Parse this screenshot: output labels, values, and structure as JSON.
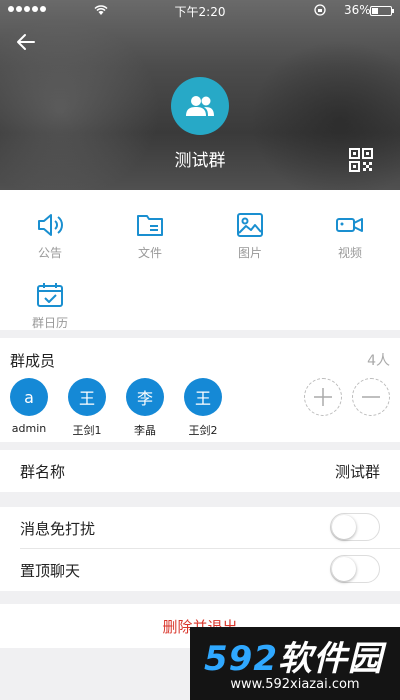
{
  "status_bar": {
    "time": "下午2:20",
    "battery": "36%",
    "battery_level": 0.36
  },
  "header": {
    "title": "测试群"
  },
  "functions": [
    {
      "label": "公告",
      "icon": "speaker-icon"
    },
    {
      "label": "文件",
      "icon": "folder-icon"
    },
    {
      "label": "图片",
      "icon": "image-icon"
    },
    {
      "label": "视频",
      "icon": "video-camera-icon"
    },
    {
      "label": "群日历",
      "icon": "calendar-icon"
    }
  ],
  "members_section": {
    "title": "群成员",
    "count": "4人",
    "members": [
      {
        "avatar": "a",
        "name": "admin"
      },
      {
        "avatar": "王",
        "name": "王剑1"
      },
      {
        "avatar": "李",
        "name": "李晶"
      },
      {
        "avatar": "王",
        "name": "王剑2"
      }
    ]
  },
  "group_name": {
    "label": "群名称",
    "value": "测试群"
  },
  "settings": [
    {
      "label": "消息免打扰",
      "on": false
    },
    {
      "label": "置顶聊天",
      "on": false
    }
  ],
  "delete_label": "删除并退出",
  "watermark": {
    "logo_num": "592",
    "logo_text": "软件园",
    "url": "www.592xiazai.com"
  },
  "colors": {
    "accent": "#27a9c7",
    "member_avatar": "#1589d6",
    "icon": "#1a8fd0",
    "danger": "#d9362b"
  }
}
